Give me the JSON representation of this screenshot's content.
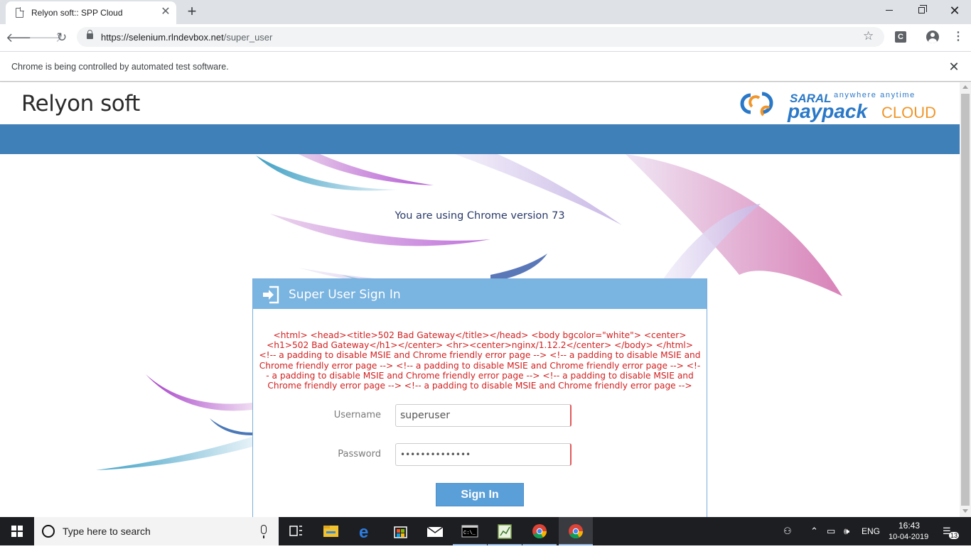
{
  "browser": {
    "tab_title": "Relyon soft:: SPP Cloud",
    "new_tab": "+",
    "url_host": "https://selenium.rlndevbox.net",
    "url_path": "/super_user",
    "ext_label": "C",
    "infobar_text": "Chrome is being controlled by automated test software."
  },
  "site": {
    "name": "Relyon soft",
    "logo_saral": "SARAL",
    "logo_tagline": "anywhere anytime",
    "logo_paypack": "paypack",
    "logo_cloud": "CLOUD",
    "chrome_version": "You are using Chrome version 73"
  },
  "signin": {
    "title": "Super User Sign In",
    "error": "<html> <head><title>502 Bad Gateway</title></head> <body bgcolor=\"white\"> <center><h1>502 Bad Gateway</h1></center> <hr><center>nginx/1.12.2</center> </body> </html> <!-- a padding to disable MSIE and Chrome friendly error page --> <!-- a padding to disable MSIE and Chrome friendly error page --> <!-- a padding to disable MSIE and Chrome friendly error page --> <!-- a padding to disable MSIE and Chrome friendly error page --> <!-- a padding to disable MSIE and Chrome friendly error page --> <!-- a padding to disable MSIE and Chrome friendly error page -->",
    "username_label": "Username",
    "username_value": "superuser",
    "password_label": "Password",
    "password_value": "••••••••••••••",
    "button": "Sign In"
  },
  "taskbar": {
    "search_placeholder": "Type here to search",
    "language": "ENG",
    "time": "16:43",
    "date": "10-04-2019",
    "notifications": "13"
  },
  "colors": {
    "header_band": "#4080b8",
    "panel_head": "#7ab4e0",
    "error_text": "#d22020",
    "signin_button": "#5b9fd8"
  }
}
